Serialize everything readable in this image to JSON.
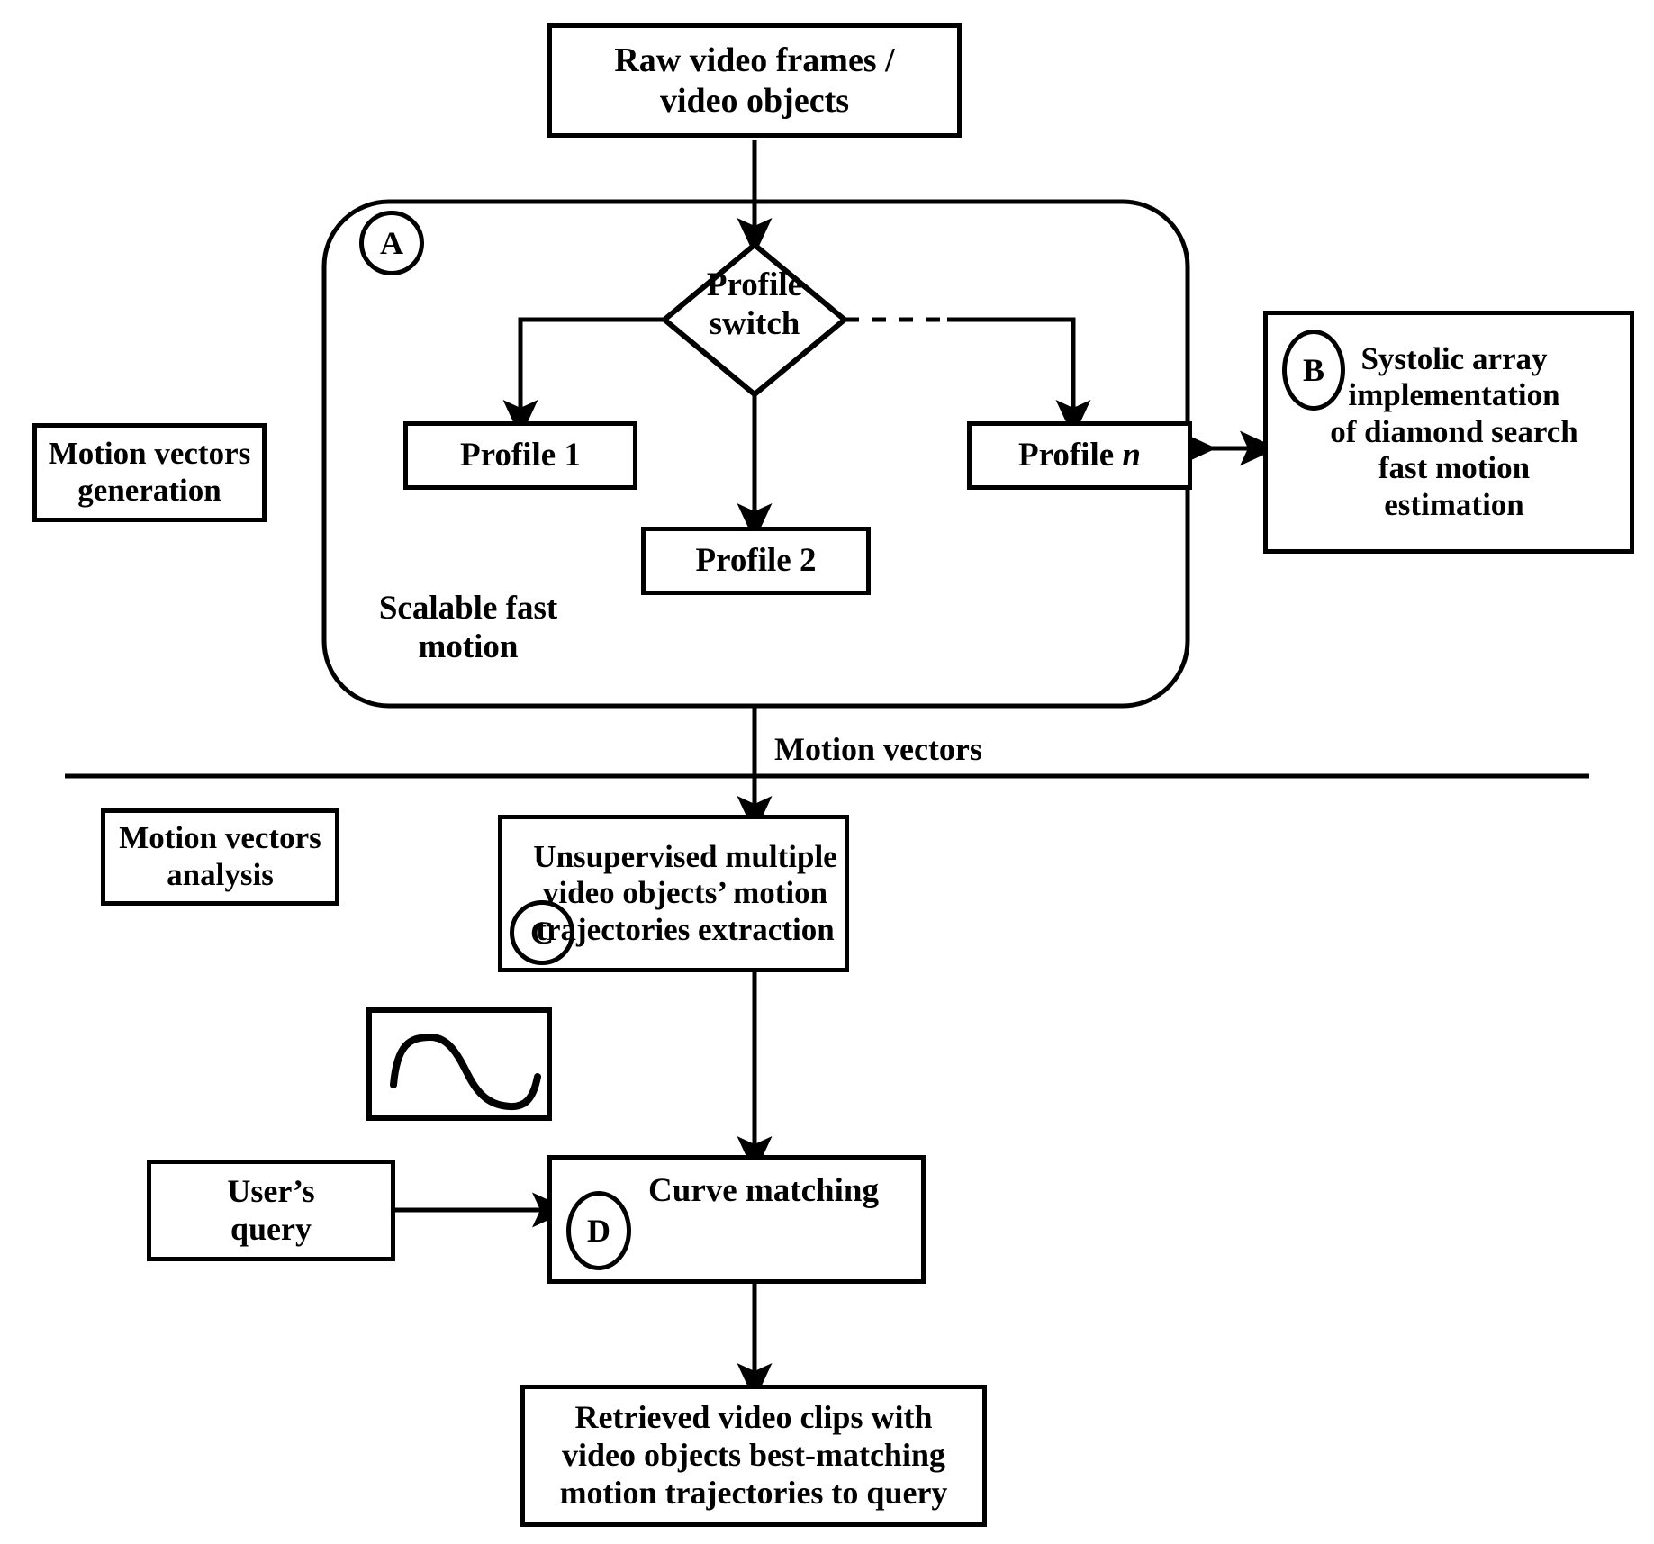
{
  "diagram": {
    "title_nodes": {
      "raw_video": "Raw video frames /\nvideo objects",
      "profile_switch": "Profile\nswitch",
      "profile_1": "Profile 1",
      "profile_2": "Profile 2",
      "profile_n_prefix": "Profile ",
      "profile_n_italic": "n",
      "motion_vectors_generation": "Motion vectors\ngeneration",
      "scalable_fast_motion": "Scalable fast\nmotion",
      "systolic_array": "Systolic array\nimplementation\nof diamond search\nfast motion\nestimation",
      "motion_vectors_edge_label": "Motion vectors",
      "motion_vectors_analysis": "Motion vectors\nanalysis",
      "trajectories_extraction": "Unsupervised multiple\nvideo objects’ motion\ntrajectories extraction",
      "curve_matching": "Curve matching",
      "users_query": "User’s\nquery",
      "retrieved_clips": "Retrieved video clips with\nvideo objects best-matching\nmotion trajectories to query"
    },
    "markers": {
      "a": "A",
      "b": "B",
      "c": "C",
      "d": "D"
    },
    "colors": {
      "stroke": "#000000",
      "background": "#ffffff"
    },
    "curve_thumbnail": {
      "name": "motion-trajectory-curve",
      "description": "trajectory curve sample"
    }
  }
}
